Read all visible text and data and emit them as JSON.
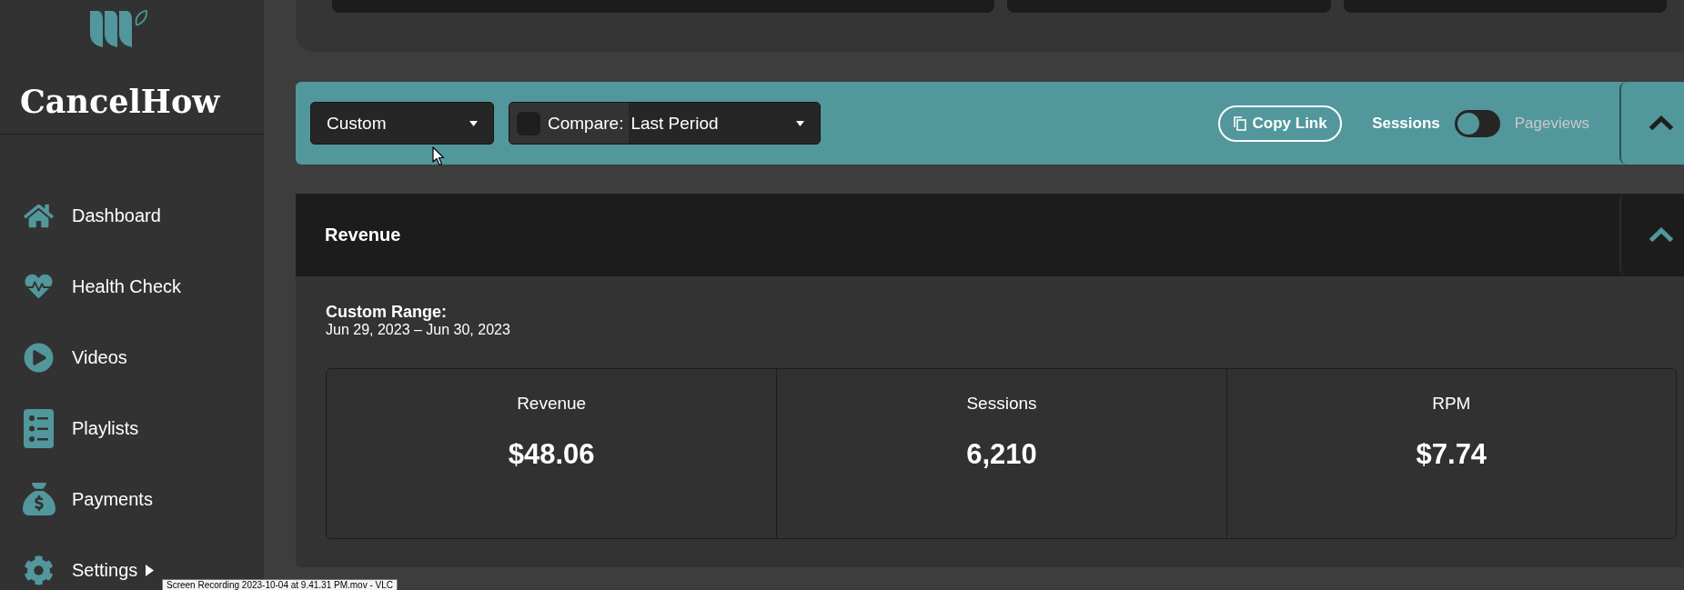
{
  "sidebar": {
    "brand": "CancelHow",
    "items": [
      {
        "label": "Dashboard",
        "kind": "link",
        "selected": false
      },
      {
        "label": "Health Check",
        "kind": "link",
        "selected": false
      },
      {
        "label": "Videos",
        "kind": "link",
        "selected": false
      },
      {
        "label": "Playlists",
        "kind": "link",
        "selected": false
      },
      {
        "label": "Payments",
        "kind": "link",
        "selected": false
      },
      {
        "label": "Settings",
        "kind": "submenu",
        "selected": false
      }
    ]
  },
  "toolbar": {
    "date_range": {
      "value": "Custom"
    },
    "compare": {
      "checked": false,
      "label": "Compare:",
      "value": "Last Period"
    },
    "copy_link": "Copy Link",
    "metric_toggle": [
      {
        "label": "Sessions",
        "selected": true
      },
      {
        "label": "Pageviews",
        "selected": false
      }
    ],
    "expanded": true
  },
  "revenue": {
    "title": "Revenue",
    "expanded": true,
    "range_label": "Custom Range:",
    "range": "Jun 29, 2023 – Jun 30, 2023",
    "stats": [
      {
        "label": "Revenue",
        "value": "$48.06"
      },
      {
        "label": "Sessions",
        "value": "6,210"
      },
      {
        "label": "RPM",
        "value": "$7.74"
      }
    ]
  },
  "tooltip": {
    "text": "Screen Recording 2023-10-04 at 9.41.31 PM.mov - VLC"
  }
}
